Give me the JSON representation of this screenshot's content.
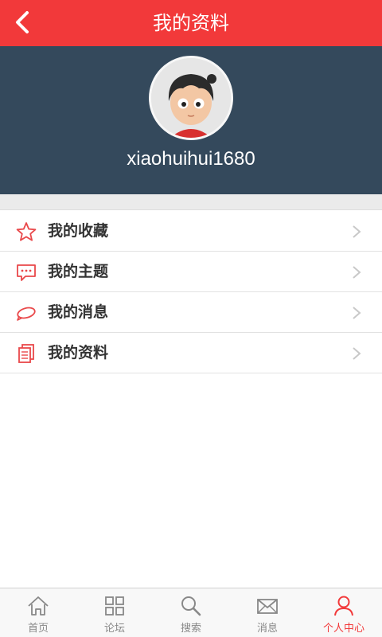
{
  "header": {
    "title": "我的资料",
    "back_icon": "chevron-left-icon",
    "background": "#f2393a"
  },
  "profile": {
    "username": "xiaohuihui1680",
    "background": "#34495c"
  },
  "menu": {
    "items": [
      {
        "label": "我的收藏",
        "icon": "star-icon"
      },
      {
        "label": "我的主题",
        "icon": "chat-bubble-icon"
      },
      {
        "label": "我的消息",
        "icon": "message-ring-icon"
      },
      {
        "label": "我的资料",
        "icon": "document-icon"
      }
    ],
    "accent": "#e9484a"
  },
  "tabbar": {
    "items": [
      {
        "label": "首页",
        "icon": "home-icon"
      },
      {
        "label": "论坛",
        "icon": "grid-icon"
      },
      {
        "label": "搜索",
        "icon": "search-icon"
      },
      {
        "label": "消息",
        "icon": "envelope-icon"
      },
      {
        "label": "个人中心",
        "icon": "person-icon"
      }
    ],
    "active_index": 4,
    "active_color": "#f2393a"
  }
}
